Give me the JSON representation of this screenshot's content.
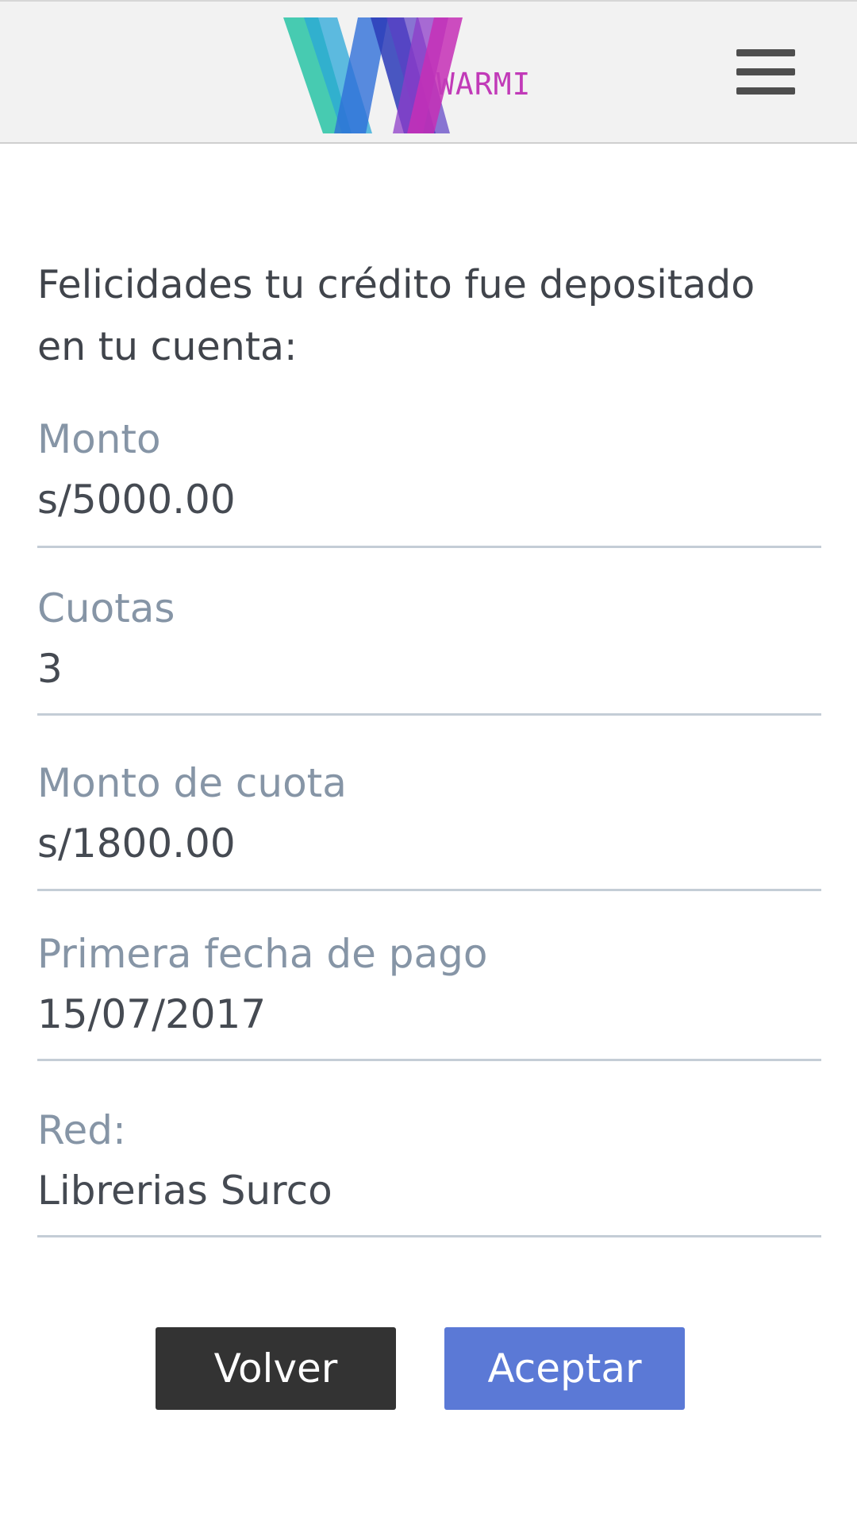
{
  "header": {
    "logo_text": "WARMI",
    "menu_icon": "hamburger-menu-icon"
  },
  "intro": {
    "message": "Felicidades tu crédito fue depositado en tu cuenta:"
  },
  "fields": [
    {
      "label": "Monto",
      "value": "s/5000.00"
    },
    {
      "label": "Cuotas",
      "value": "3"
    },
    {
      "label": "Monto de cuota",
      "value": "s/1800.00"
    },
    {
      "label": "Primera fecha de pago",
      "value": "15/07/2017"
    },
    {
      "label": "Red:",
      "value": "Librerias Surco"
    }
  ],
  "buttons": {
    "back_label": "Volver",
    "accept_label": "Aceptar"
  },
  "colors": {
    "accent": "#5b79d6",
    "dark_button": "#333333",
    "label": "#8695a6",
    "brand_pink": "#c13ab8"
  }
}
